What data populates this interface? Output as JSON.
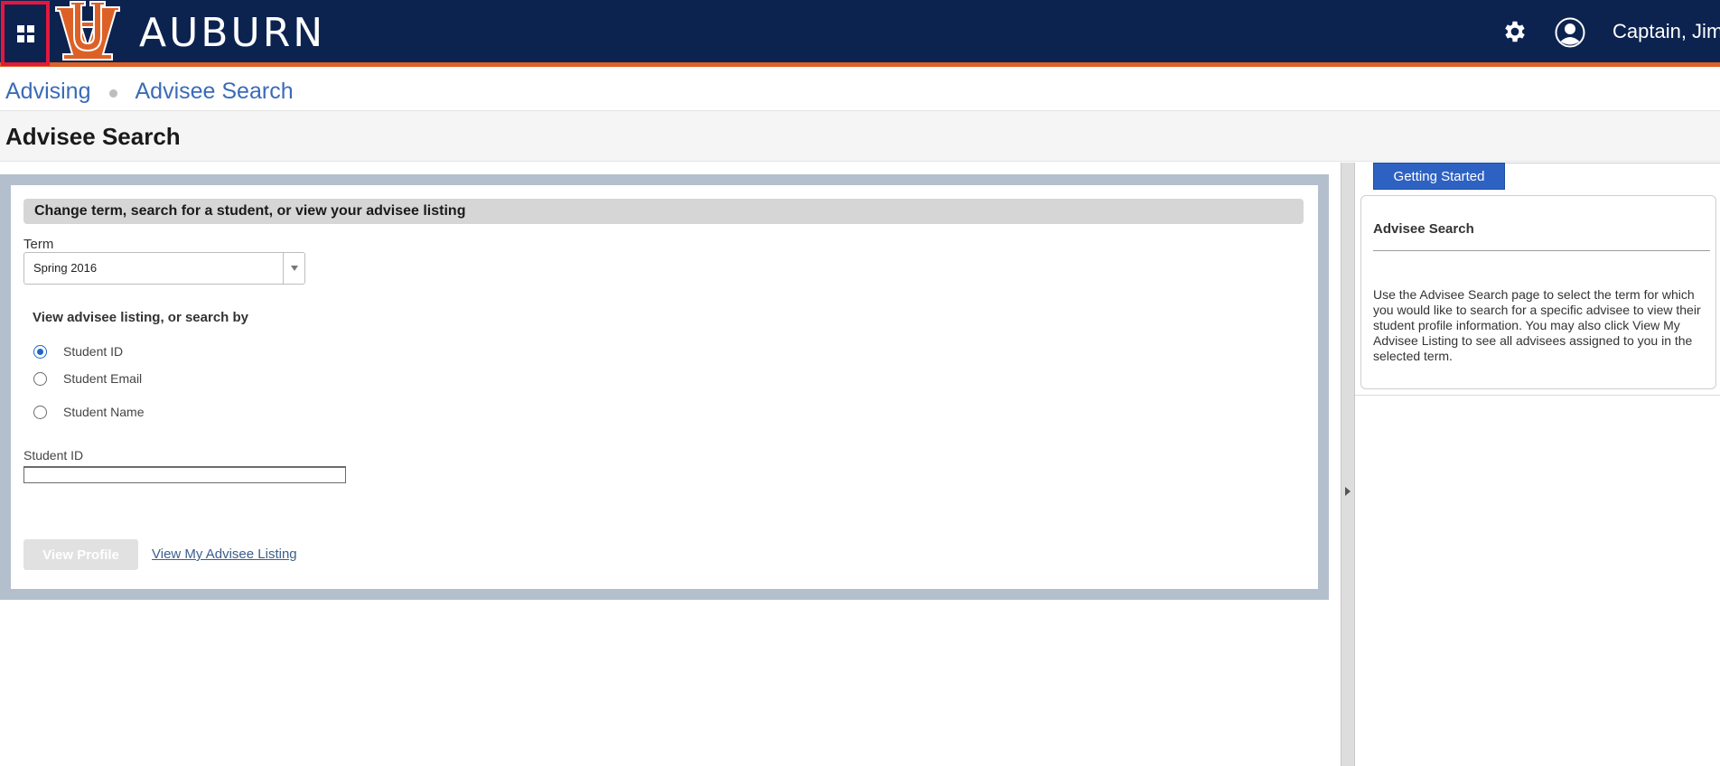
{
  "header": {
    "brand": "AUBURN",
    "user_name": "Captain, Jim",
    "colors": {
      "navy": "#0c2350",
      "orange": "#dd6126",
      "highlight": "#e3183c"
    },
    "icons": {
      "apps": "grid-icon",
      "settings": "gear-icon",
      "profile": "user-circle-icon",
      "logo": "auburn-au-logo"
    }
  },
  "breadcrumb": {
    "items": [
      {
        "label": "Advising"
      },
      {
        "label": "Advisee Search"
      }
    ]
  },
  "page": {
    "title": "Advisee Search"
  },
  "form": {
    "section_header": "Change term, search for a student, or view your advisee listing",
    "term_label": "Term",
    "term_value": "Spring 2016",
    "search_by_label": "View advisee listing, or search by",
    "options": [
      {
        "label": "Student ID",
        "selected": true
      },
      {
        "label": "Student Email",
        "selected": false
      },
      {
        "label": "Student Name",
        "selected": false
      }
    ],
    "student_id_label": "Student ID",
    "student_id_value": "",
    "view_profile_label": "View Profile",
    "listing_link_label": "View My Advisee Listing"
  },
  "sidebar": {
    "tab_label": "Getting Started",
    "card_title": "Advisee Search",
    "card_text": "Use the Advisee Search page to select the term for which you would like to search for a specific advisee to view their student profile information. You may also click View My Advisee Listing to see all advisees assigned to you in the selected term."
  }
}
